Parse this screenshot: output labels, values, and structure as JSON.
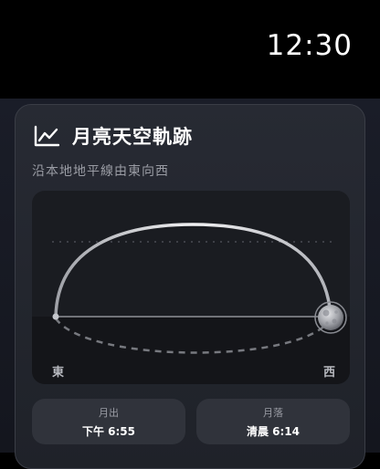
{
  "status": {
    "time": "12:30"
  },
  "card": {
    "icon": "line-chart-icon",
    "title": "月亮天空軌跡",
    "subtitle": "沿本地地平線由東向西"
  },
  "chart": {
    "label_east": "東",
    "label_west": "西",
    "moon_icon": "moon-icon"
  },
  "moonrise": {
    "label": "月出",
    "value": "下午 6:55"
  },
  "moonset": {
    "label": "月落",
    "value": "清晨 6:14"
  },
  "colors": {
    "background": "#000000",
    "card": "#272a33",
    "plot": "#1a1c21",
    "arc": "#e8e8ea",
    "secondary_text": "#9a9ca4"
  }
}
